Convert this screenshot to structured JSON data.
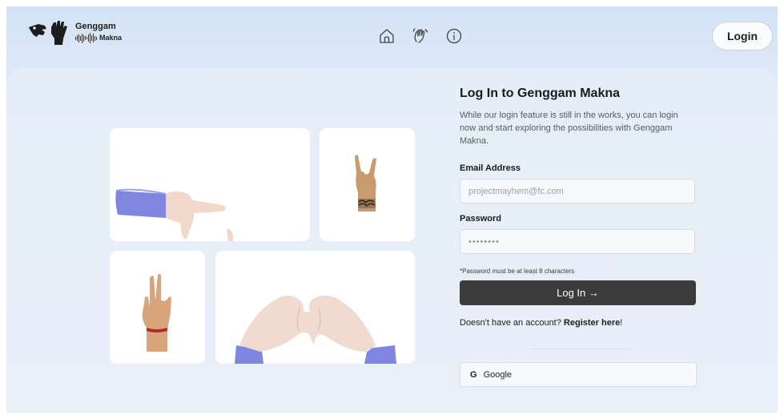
{
  "header": {
    "logo": {
      "title": "Genggam",
      "subtitle": "Makna"
    },
    "nav": [
      {
        "icon": "home-icon"
      },
      {
        "icon": "wave-hand-icon"
      },
      {
        "icon": "info-icon"
      }
    ],
    "login_label": "Login"
  },
  "form": {
    "title": "Log In to Genggam Makna",
    "description": "While our login feature is still in the works, you can login now and start exploring the possibilities with Genggam Makna.",
    "email_label": "Email Address",
    "email_placeholder": "projectmayhem@fc.com",
    "password_label": "Password",
    "password_value": "••••••••",
    "password_hint": "*Password must be at least 8 characters",
    "submit_label": "Log In →",
    "register_prompt": "Doesn't have an account?",
    "register_link": "Register here",
    "register_suffix": "!",
    "google_icon": "google-icon",
    "google_label": "Google"
  },
  "gallery": [
    {
      "name": "hand-pointing-sign"
    },
    {
      "name": "hand-rock-sign"
    },
    {
      "name": "hand-two-fingers-sign"
    },
    {
      "name": "hands-heart-sign"
    }
  ],
  "colors": {
    "accent_dark": "#3b3b3b",
    "background": "#e5edf8",
    "sleeve": "#7f86e0"
  }
}
